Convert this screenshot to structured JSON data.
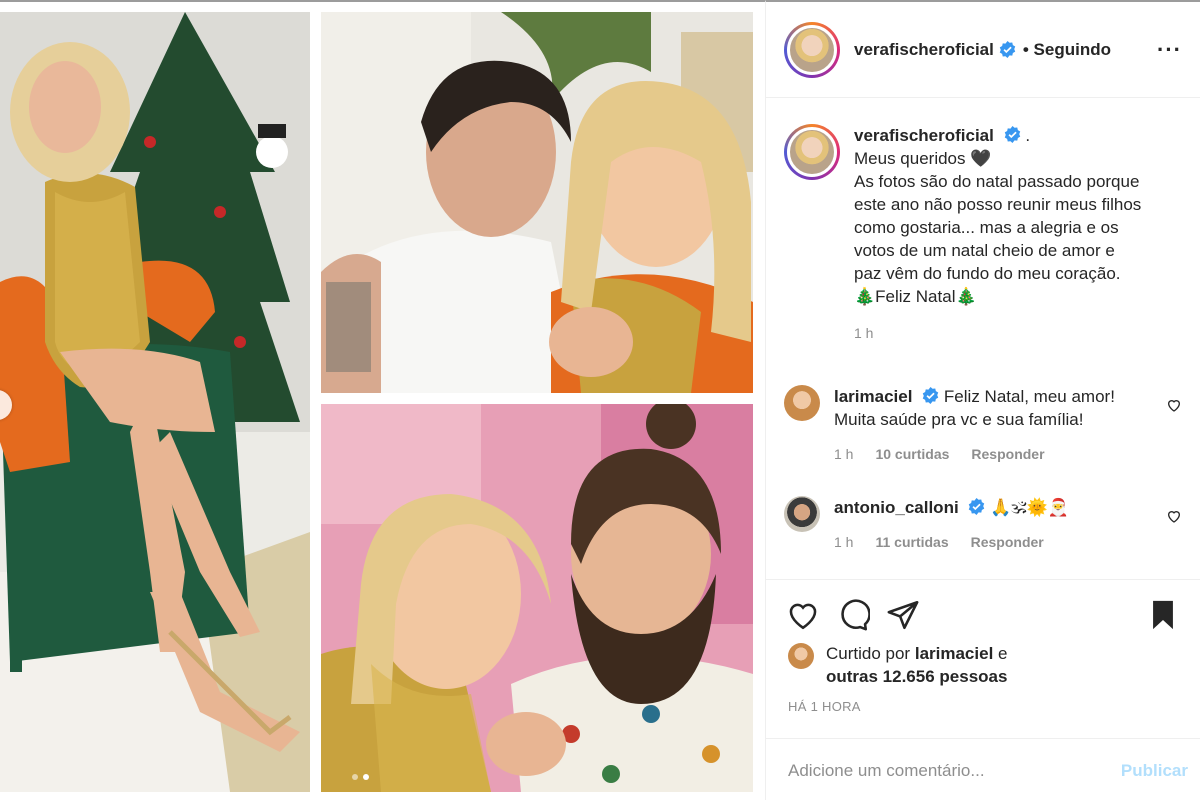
{
  "post": {
    "username": "verafischeroficial",
    "follow_status": "• Seguindo",
    "more_icon": "more-options-icon",
    "caption": {
      "username": "verafischeroficial",
      "suffix": ".",
      "lines": [
        "Meus queridos 🖤",
        "As fotos são do natal passado porque",
        "este ano não posso reunir meus filhos",
        "como gostaria... mas a alegria e os",
        "votos de um natal cheio de amor e",
        "paz vêm do fundo do meu coração.",
        "🎄Feliz Natal🎄"
      ],
      "time": "1 h"
    },
    "comments": [
      {
        "username": "larimaciel",
        "text": "Feliz Natal, meu amor! Muita saúde pra vc e sua família!",
        "time": "1 h",
        "likes": "10 curtidas",
        "reply": "Responder"
      },
      {
        "username": "antonio_calloni",
        "text": "🙏🕉🌞🎅",
        "time": "1 h",
        "likes": "11 curtidas",
        "reply": "Responder"
      }
    ],
    "liked_by_prefix": "Curtido por",
    "liked_by_user": "larimaciel",
    "liked_by_mid": "e",
    "liked_by_others": "outras 12.656 pessoas",
    "posted_time": "HÁ 1 HORA",
    "comment_placeholder": "Adicione um comentário...",
    "publish_label": "Publicar"
  },
  "carousel": {
    "current": 2,
    "total": 2
  },
  "colors": {
    "accent": "#0095f6",
    "publish_disabled": "#b2dffc",
    "muted": "#8e8e8e"
  }
}
